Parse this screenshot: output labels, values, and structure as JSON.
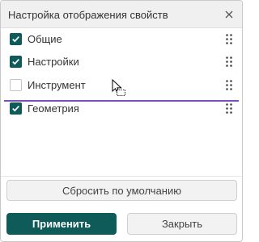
{
  "dialog": {
    "title": "Настройка отображения свойств",
    "close_icon": "close-icon"
  },
  "items": [
    {
      "label": "Общие",
      "checked": true
    },
    {
      "label": "Настройки",
      "checked": true
    },
    {
      "label": "Инструмент",
      "checked": false
    },
    {
      "label": "Геометрия",
      "checked": true
    }
  ],
  "drag_icon": "drag-handle-icon",
  "cursor_icon": "move-cursor-icon",
  "colors": {
    "accent": "#0f5b59",
    "drop_indicator": "#7c4fb8"
  },
  "buttons": {
    "reset": "Сбросить по умолчанию",
    "apply": "Применить",
    "close": "Закрыть"
  }
}
